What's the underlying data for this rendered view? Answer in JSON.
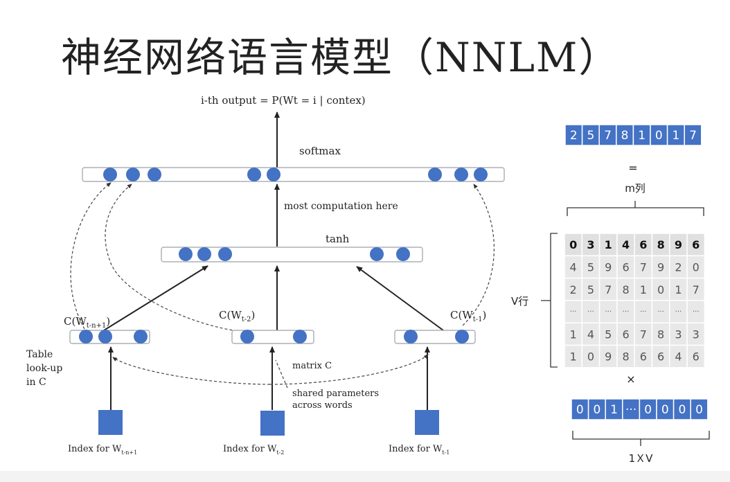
{
  "title": "神经网络语言模型（NNLM）",
  "output_label": "i-th output = P(Wt = i | contex)",
  "softmax_label": "softmax",
  "computation_label": "most computation here",
  "tanh_label": "tanh",
  "c_labels": {
    "left": {
      "base": "C(W",
      "sub": "t-n+1",
      "close": ")"
    },
    "middle": {
      "base": "C(W",
      "sub": "t-2",
      "close": ")"
    },
    "right": {
      "base": "C(W",
      "sub": "t-1",
      "close": ")"
    }
  },
  "lookup_label": [
    "Table",
    "look-up",
    "in C"
  ],
  "matrix_label": "matrix C",
  "shared_label": [
    "shared parameters",
    "across words"
  ],
  "index_labels": {
    "left": {
      "base": "Index for W",
      "sub": "t-n+1"
    },
    "middle": {
      "base": "Index for W",
      "sub": "t-2"
    },
    "right": {
      "base": "Index for W",
      "sub": "t-1"
    }
  },
  "vector_top": [
    "2",
    "5",
    "7",
    "8",
    "1",
    "0",
    "1",
    "7"
  ],
  "equals_sign": "=",
  "m_label": "m列",
  "v_label": "V行",
  "matrix_rows": [
    [
      "0",
      "3",
      "1",
      "4",
      "6",
      "8",
      "9",
      "6"
    ],
    [
      "4",
      "5",
      "9",
      "6",
      "7",
      "9",
      "2",
      "0"
    ],
    [
      "2",
      "5",
      "7",
      "8",
      "1",
      "0",
      "1",
      "7"
    ],
    [
      "···",
      "···",
      "···",
      "···",
      "···",
      "···",
      "···",
      "···"
    ],
    [
      "1",
      "4",
      "5",
      "6",
      "7",
      "8",
      "3",
      "3"
    ],
    [
      "1",
      "0",
      "9",
      "8",
      "6",
      "6",
      "4",
      "6"
    ]
  ],
  "times_sign": "×",
  "vector_bottom": [
    "0",
    "0",
    "1",
    "···",
    "0",
    "0",
    "0",
    "0"
  ],
  "dim_label": "1ＸV",
  "colors": {
    "node": "#4472c4",
    "vector_fill": "#4472c4",
    "matrix_fill": "#e8e8e8",
    "matrix_header_fill": "#e0e0e0"
  }
}
